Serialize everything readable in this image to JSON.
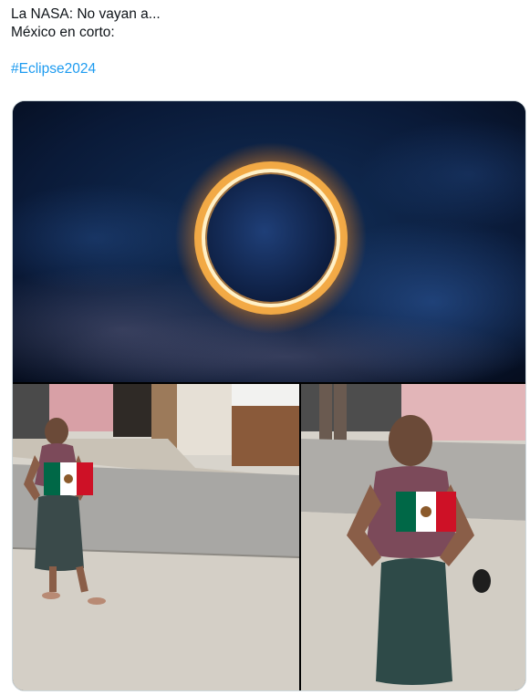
{
  "tweet": {
    "line1": "La NASA: No vayan a...",
    "line2": "México en corto:",
    "hashtag": "#Eclipse2024"
  },
  "colors": {
    "hashtag": "#1d9bf0",
    "text": "#0f1419",
    "corona": "#ffb347",
    "sky": "#071428"
  },
  "media": {
    "panels": [
      "eclipse-image",
      "woman-left-photo",
      "woman-right-photo"
    ]
  }
}
